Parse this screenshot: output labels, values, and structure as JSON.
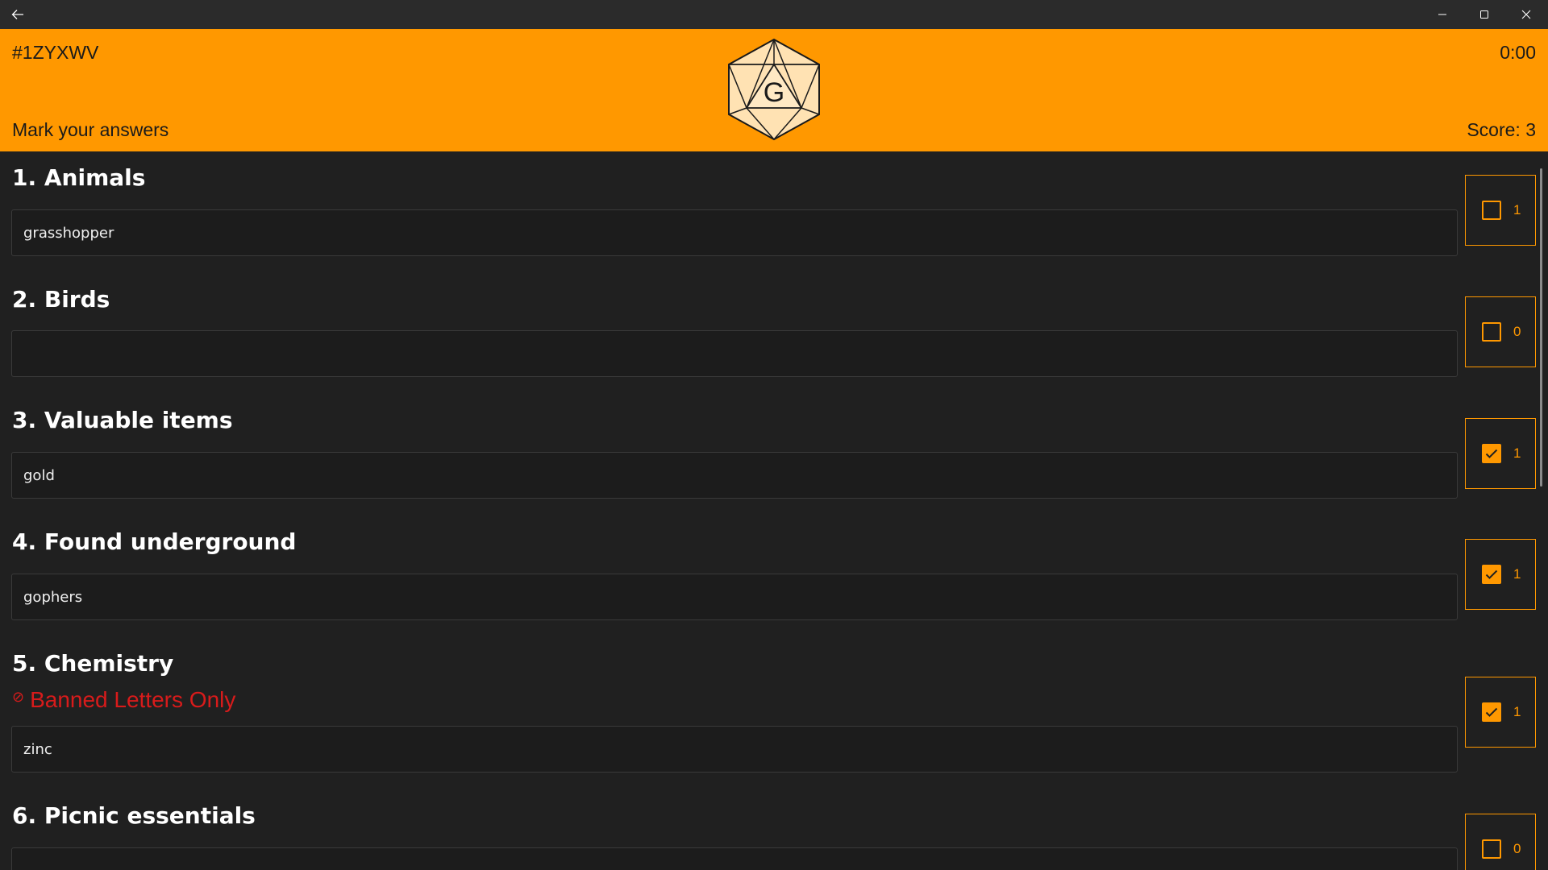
{
  "window": {
    "back_icon": "back-arrow-icon",
    "minimize_icon": "minimize-icon",
    "maximize_icon": "maximize-icon",
    "close_icon": "close-icon"
  },
  "header": {
    "game_code": "#1ZYXWV",
    "timer": "0:00",
    "subtitle": "Mark your answers",
    "score": "Score: 3",
    "die_letter": "G",
    "accent_color": "#ff9800"
  },
  "categories": [
    {
      "title": "1. Animals",
      "answer": "grasshopper",
      "checked": false,
      "points": "1"
    },
    {
      "title": "2. Birds",
      "answer": "",
      "checked": false,
      "points": "0"
    },
    {
      "title": "3. Valuable items",
      "answer": "gold",
      "checked": true,
      "points": "1"
    },
    {
      "title": "4. Found underground",
      "answer": "gophers",
      "checked": true,
      "points": "1"
    },
    {
      "title": "5. Chemistry",
      "warning": "Banned Letters Only",
      "answer": "zinc",
      "checked": true,
      "points": "1"
    },
    {
      "title": "6. Picnic essentials",
      "answer": "",
      "checked": false,
      "points": "0"
    }
  ],
  "colors": {
    "banned": "#d81b1b",
    "background": "#202020"
  }
}
